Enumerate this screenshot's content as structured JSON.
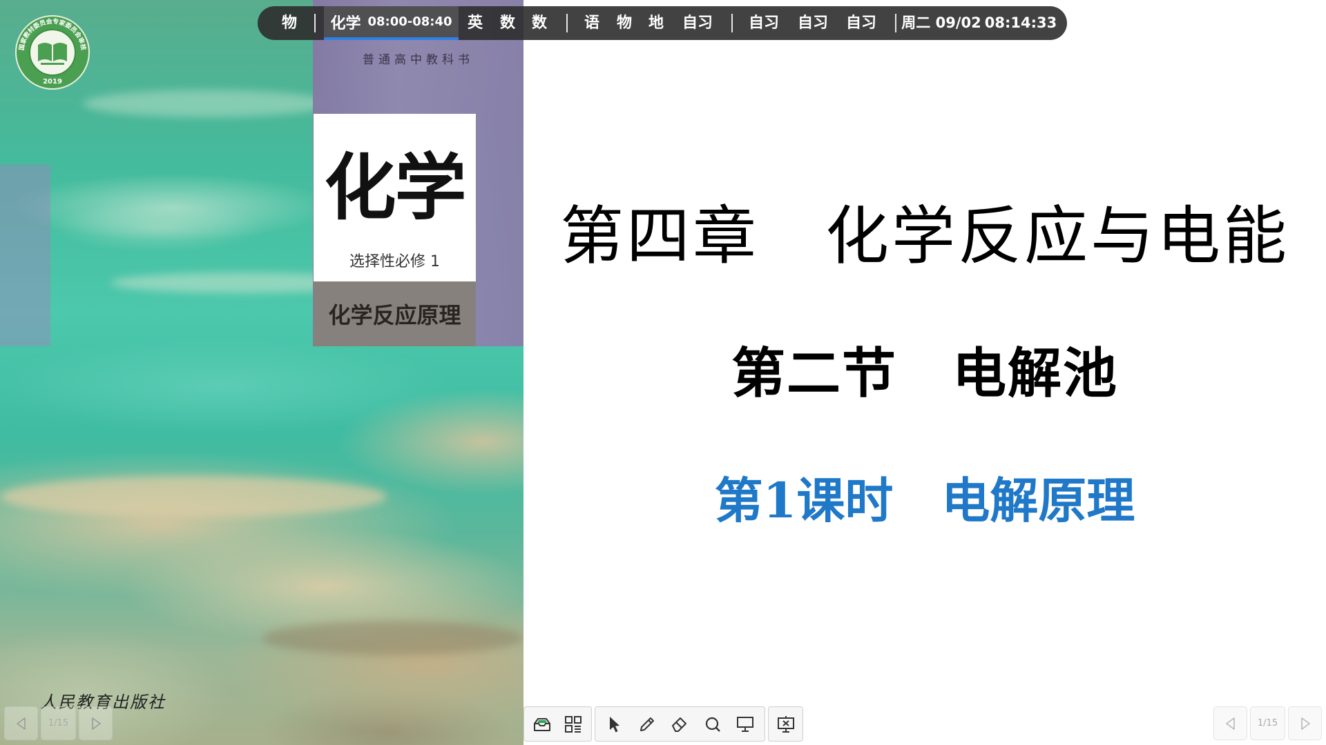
{
  "schedule": {
    "periods": [
      "物",
      "化学",
      "英",
      "数",
      "数",
      "语",
      "物",
      "地",
      "自习",
      "自习",
      "自习",
      "自习"
    ],
    "current_period_time": "08:00-08:40",
    "date": "周二 09/02",
    "clock": "08:14:33",
    "accent_color": "#2f80e6"
  },
  "cover": {
    "series": "普通高中教科书",
    "subject": "化学",
    "volume": "选择性必修 1",
    "book_title": "化学反应原理",
    "publisher": "人民教育出版社",
    "seal_text": "国家教材委员会专家委员会审核通过",
    "seal_year": "2019"
  },
  "slide": {
    "chapter": "第四章　化学反应与电能",
    "section": "第二节　电解池",
    "lesson": "第1课时　电解原理",
    "lesson_color": "#1f78c8"
  },
  "toolbar": {
    "icons": [
      "whiteboard-tray-icon",
      "apps-grid-icon",
      "pointer-icon",
      "pen-icon",
      "eraser-icon",
      "search-icon",
      "screen-board-icon",
      "end-presentation-icon"
    ]
  },
  "pager_left": {
    "page": "1/15",
    "prev_icon": "chevron-left-icon",
    "next_icon": "chevron-right-icon"
  },
  "pager_right": {
    "page": "1/15",
    "prev_icon": "chevron-left-icon",
    "next_icon": "chevron-right-icon"
  }
}
